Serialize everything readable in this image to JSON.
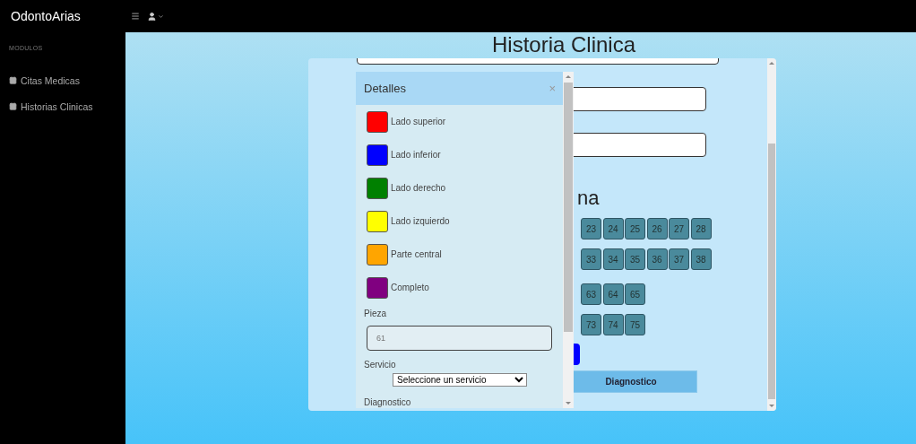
{
  "app": {
    "brand": "OdontoArias"
  },
  "sidebar": {
    "section": "MODULOS",
    "items": [
      {
        "label": "Citas Medicas"
      },
      {
        "label": "Historias Clinicas"
      }
    ]
  },
  "page": {
    "title": "Historia Clinica"
  },
  "form": {
    "heading_fragment": "na",
    "teeth_rows": [
      [
        "23",
        "24",
        "25",
        "26",
        "27",
        "28"
      ],
      [
        "33",
        "34",
        "35",
        "36",
        "37",
        "38"
      ],
      [
        "63",
        "64",
        "65"
      ],
      [
        "73",
        "74",
        "75"
      ]
    ],
    "diagnosis_button": "Diagnostico"
  },
  "modal": {
    "title": "Detalles",
    "close": "×",
    "surfaces": [
      {
        "label": "Lado superior",
        "color": "#ff0000"
      },
      {
        "label": "Lado inferior",
        "color": "#0000ff"
      },
      {
        "label": "Lado derecho",
        "color": "#008000"
      },
      {
        "label": "Lado izquierdo",
        "color": "#ffff00"
      },
      {
        "label": "Parte central",
        "color": "#ffa500"
      },
      {
        "label": "Completo",
        "color": "#800080"
      }
    ],
    "piece": {
      "label": "Pieza",
      "value": "61"
    },
    "service": {
      "label": "Servicio",
      "value": "Seleccione un servicio"
    },
    "diagnosis_label": "Diagnostico"
  }
}
